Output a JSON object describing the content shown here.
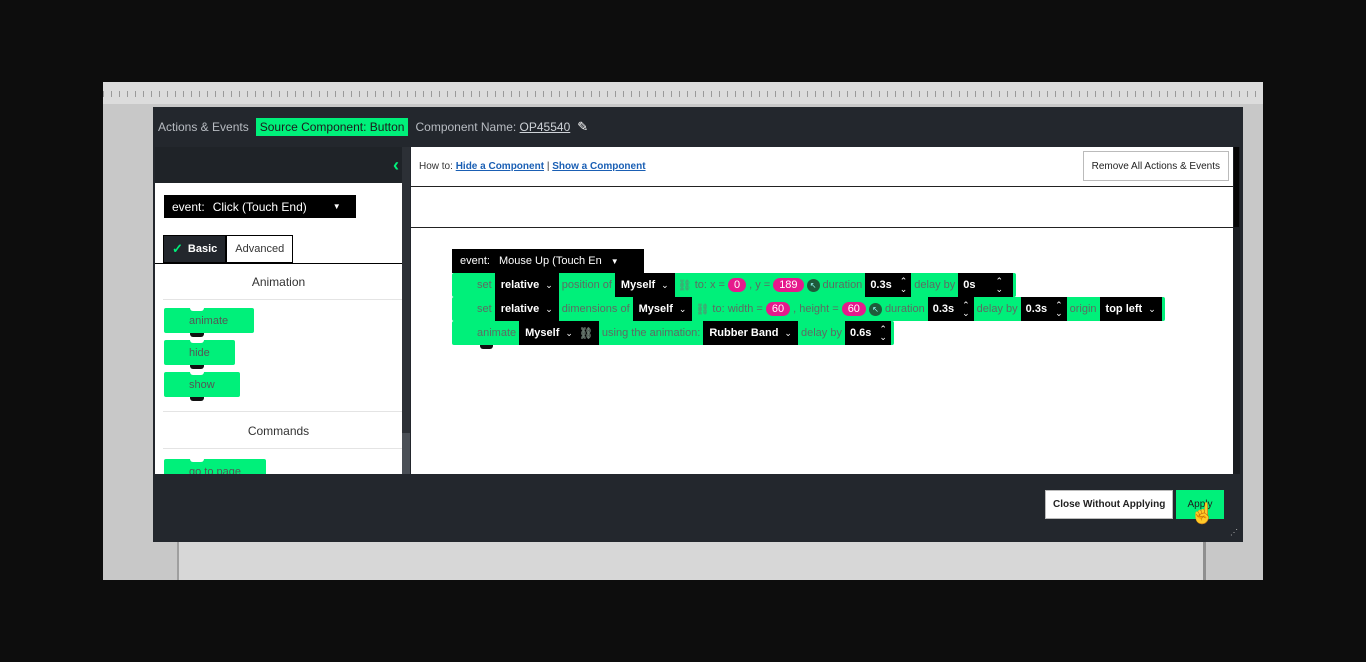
{
  "header": {
    "title": "Actions & Events",
    "source_badge": "Source Component: Button",
    "component_name_label": "Component Name:",
    "component_name": "OP45540"
  },
  "left": {
    "event_label": "event:",
    "event_value": "Click (Touch End)",
    "tabs": [
      "Basic",
      "Advanced"
    ],
    "sections": [
      "Animation",
      "Commands"
    ],
    "blocks": [
      "animate",
      "hide",
      "show",
      "go to page"
    ]
  },
  "howto": {
    "prefix": "How to:",
    "link1": "Hide a Component",
    "sep": "|",
    "link2": "Show a Component",
    "remove_button": "Remove All Actions & Events"
  },
  "workspace": {
    "event_label": "event:",
    "event_value": "Mouse Up (Touch En",
    "row1": {
      "verb": "set",
      "mode": "relative",
      "prop": "position of",
      "target": "Myself",
      "to_x": "to: x =",
      "x": "0",
      "y_label": ", y =",
      "y": "189",
      "duration_label": "duration",
      "duration": "0.3s",
      "delay_label": "delay by",
      "delay": "0s"
    },
    "row2": {
      "verb": "set",
      "mode": "relative",
      "prop": "dimensions of",
      "target": "Myself",
      "w_label": "to: width =",
      "w": "60",
      "h_label": ", height =",
      "h": "60",
      "duration_label": "duration",
      "duration": "0.3s",
      "delay_label": "delay by",
      "delay": "0.3s",
      "origin_label": "origin",
      "origin": "top left"
    },
    "row3": {
      "verb": "animate",
      "target": "Myself",
      "using": "using the animation:",
      "animation": "Rubber Band",
      "delay_label": "delay by",
      "delay": "0.6s"
    }
  },
  "footer": {
    "close_button": "Close Without Applying",
    "apply_button": "Apply"
  },
  "colors": {
    "accent": "#00f07a",
    "pill": "#e6198c",
    "dark": "#23272d"
  }
}
